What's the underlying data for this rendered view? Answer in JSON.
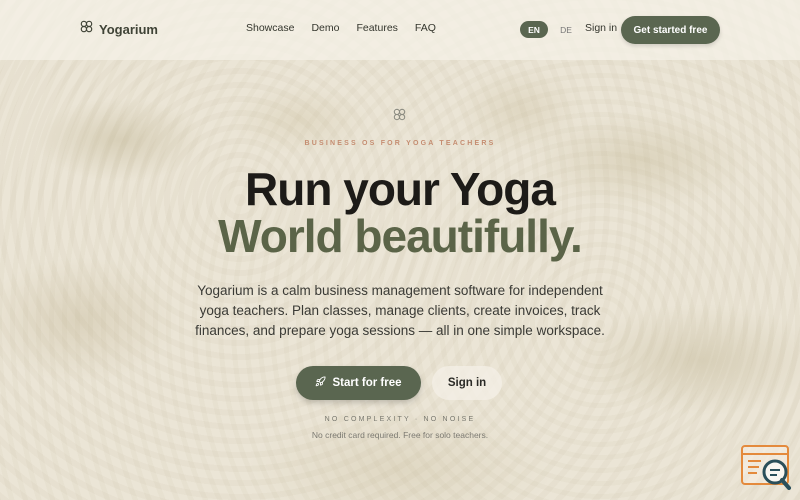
{
  "header": {
    "brand": "Yogarium",
    "nav_links": [
      "Showcase",
      "Demo",
      "Features",
      "FAQ"
    ],
    "lang_active": "EN",
    "lang_other": "DE",
    "signin": "Sign in",
    "cta": "Get started free"
  },
  "hero": {
    "eyebrow": "BUSINESS OS FOR YOGA TEACHERS",
    "title_line1": "Run your Yoga",
    "title_line2": "World beautifully.",
    "description": "Yogarium is a calm business management software for independent yoga teachers. Plan classes, manage clients, create invoices, track finances, and prepare yoga sessions — all in one simple workspace.",
    "primary_button": "Start for free",
    "secondary_button": "Sign in",
    "tagline": "NO COMPLEXITY · NO NOISE",
    "note": "No credit card required. Free for solo teachers."
  },
  "colors": {
    "accent": "#5a6650",
    "eyebrow": "#c58d71",
    "title_dark": "#1d1b18",
    "title_green": "#5b6448",
    "widget": "#e48a3c"
  },
  "icons": {
    "logo": "yoga-flower-icon",
    "hero": "yoga-flower-icon",
    "start_button": "rocket-icon",
    "widget": "chat-search-icon"
  }
}
